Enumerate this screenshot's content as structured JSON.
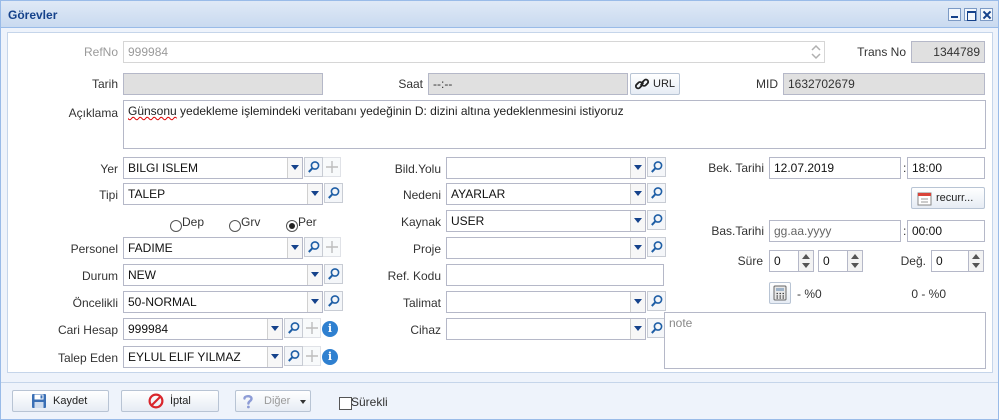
{
  "window": {
    "title": "Görevler"
  },
  "colors": {
    "title_text": "#15428b",
    "accent": "#99bbe8",
    "disabled_text": "#9a9a9a",
    "readonly_bg": "#e0e0e0"
  },
  "fields": {
    "refno": {
      "label": "RefNo",
      "value": "999984"
    },
    "trans_no": {
      "label": "Trans No",
      "value": "1344789"
    },
    "tarih": {
      "label": "Tarih",
      "value": ""
    },
    "saat": {
      "label": "Saat",
      "value": "--:--"
    },
    "url": {
      "label": "URL"
    },
    "mid": {
      "label": "MID",
      "value": "1632702679"
    },
    "aciklama": {
      "label": "Açıklama",
      "value_first_word": "Günsonu",
      "value_rest": " yedekleme işlemindeki veritabanı yedeğinin  D: dizini altına yedeklenmesini istiyoruz"
    },
    "yer": {
      "label": "Yer",
      "value": "BILGI ISLEM"
    },
    "tipi": {
      "label": "Tipi",
      "value": "TALEP"
    },
    "personel": {
      "label": "Personel",
      "value": "FADIME"
    },
    "durum": {
      "label": "Durum",
      "value": "NEW"
    },
    "oncelikli": {
      "label": "Öncelikli",
      "value": "50-NORMAL"
    },
    "cari_hesap": {
      "label": "Cari Hesap",
      "value": "999984"
    },
    "talep_eden": {
      "label": "Talep Eden",
      "value": "EYLUL ELIF YILMAZ"
    },
    "bild_yolu": {
      "label": "Bild.Yolu",
      "value": ""
    },
    "nedeni": {
      "label": "Nedeni",
      "value": "AYARLAR"
    },
    "kaynak": {
      "label": "Kaynak",
      "value": "USER"
    },
    "proje": {
      "label": "Proje",
      "value": ""
    },
    "ref_kodu": {
      "label": "Ref. Kodu",
      "value": ""
    },
    "talimat": {
      "label": "Talimat",
      "value": ""
    },
    "cihaz": {
      "label": "Cihaz",
      "value": ""
    },
    "bek_tarihi": {
      "label": "Bek. Tarihi",
      "date": "12.07.2019",
      "time": "18:00"
    },
    "recurr": {
      "label": "recurr..."
    },
    "bas_tarihi": {
      "label": "Bas.Tarihi",
      "date_placeholder": "gg.aa.yyyy",
      "time": "00:00"
    },
    "sure": {
      "label": "Süre",
      "value1": "0",
      "value2": "0"
    },
    "deg": {
      "label": "Değ.",
      "value": "0"
    },
    "percent_left": "- %0",
    "percent_right": "0 - %0",
    "note": {
      "placeholder": "note"
    }
  },
  "radios": {
    "selected": "Per",
    "options": [
      {
        "label": "Dep"
      },
      {
        "label": "Grv"
      },
      {
        "label": "Per"
      }
    ]
  },
  "bottom": {
    "save": "Kaydet",
    "cancel": "İptal",
    "other": "Diğer",
    "continuous": "Sürekli"
  }
}
